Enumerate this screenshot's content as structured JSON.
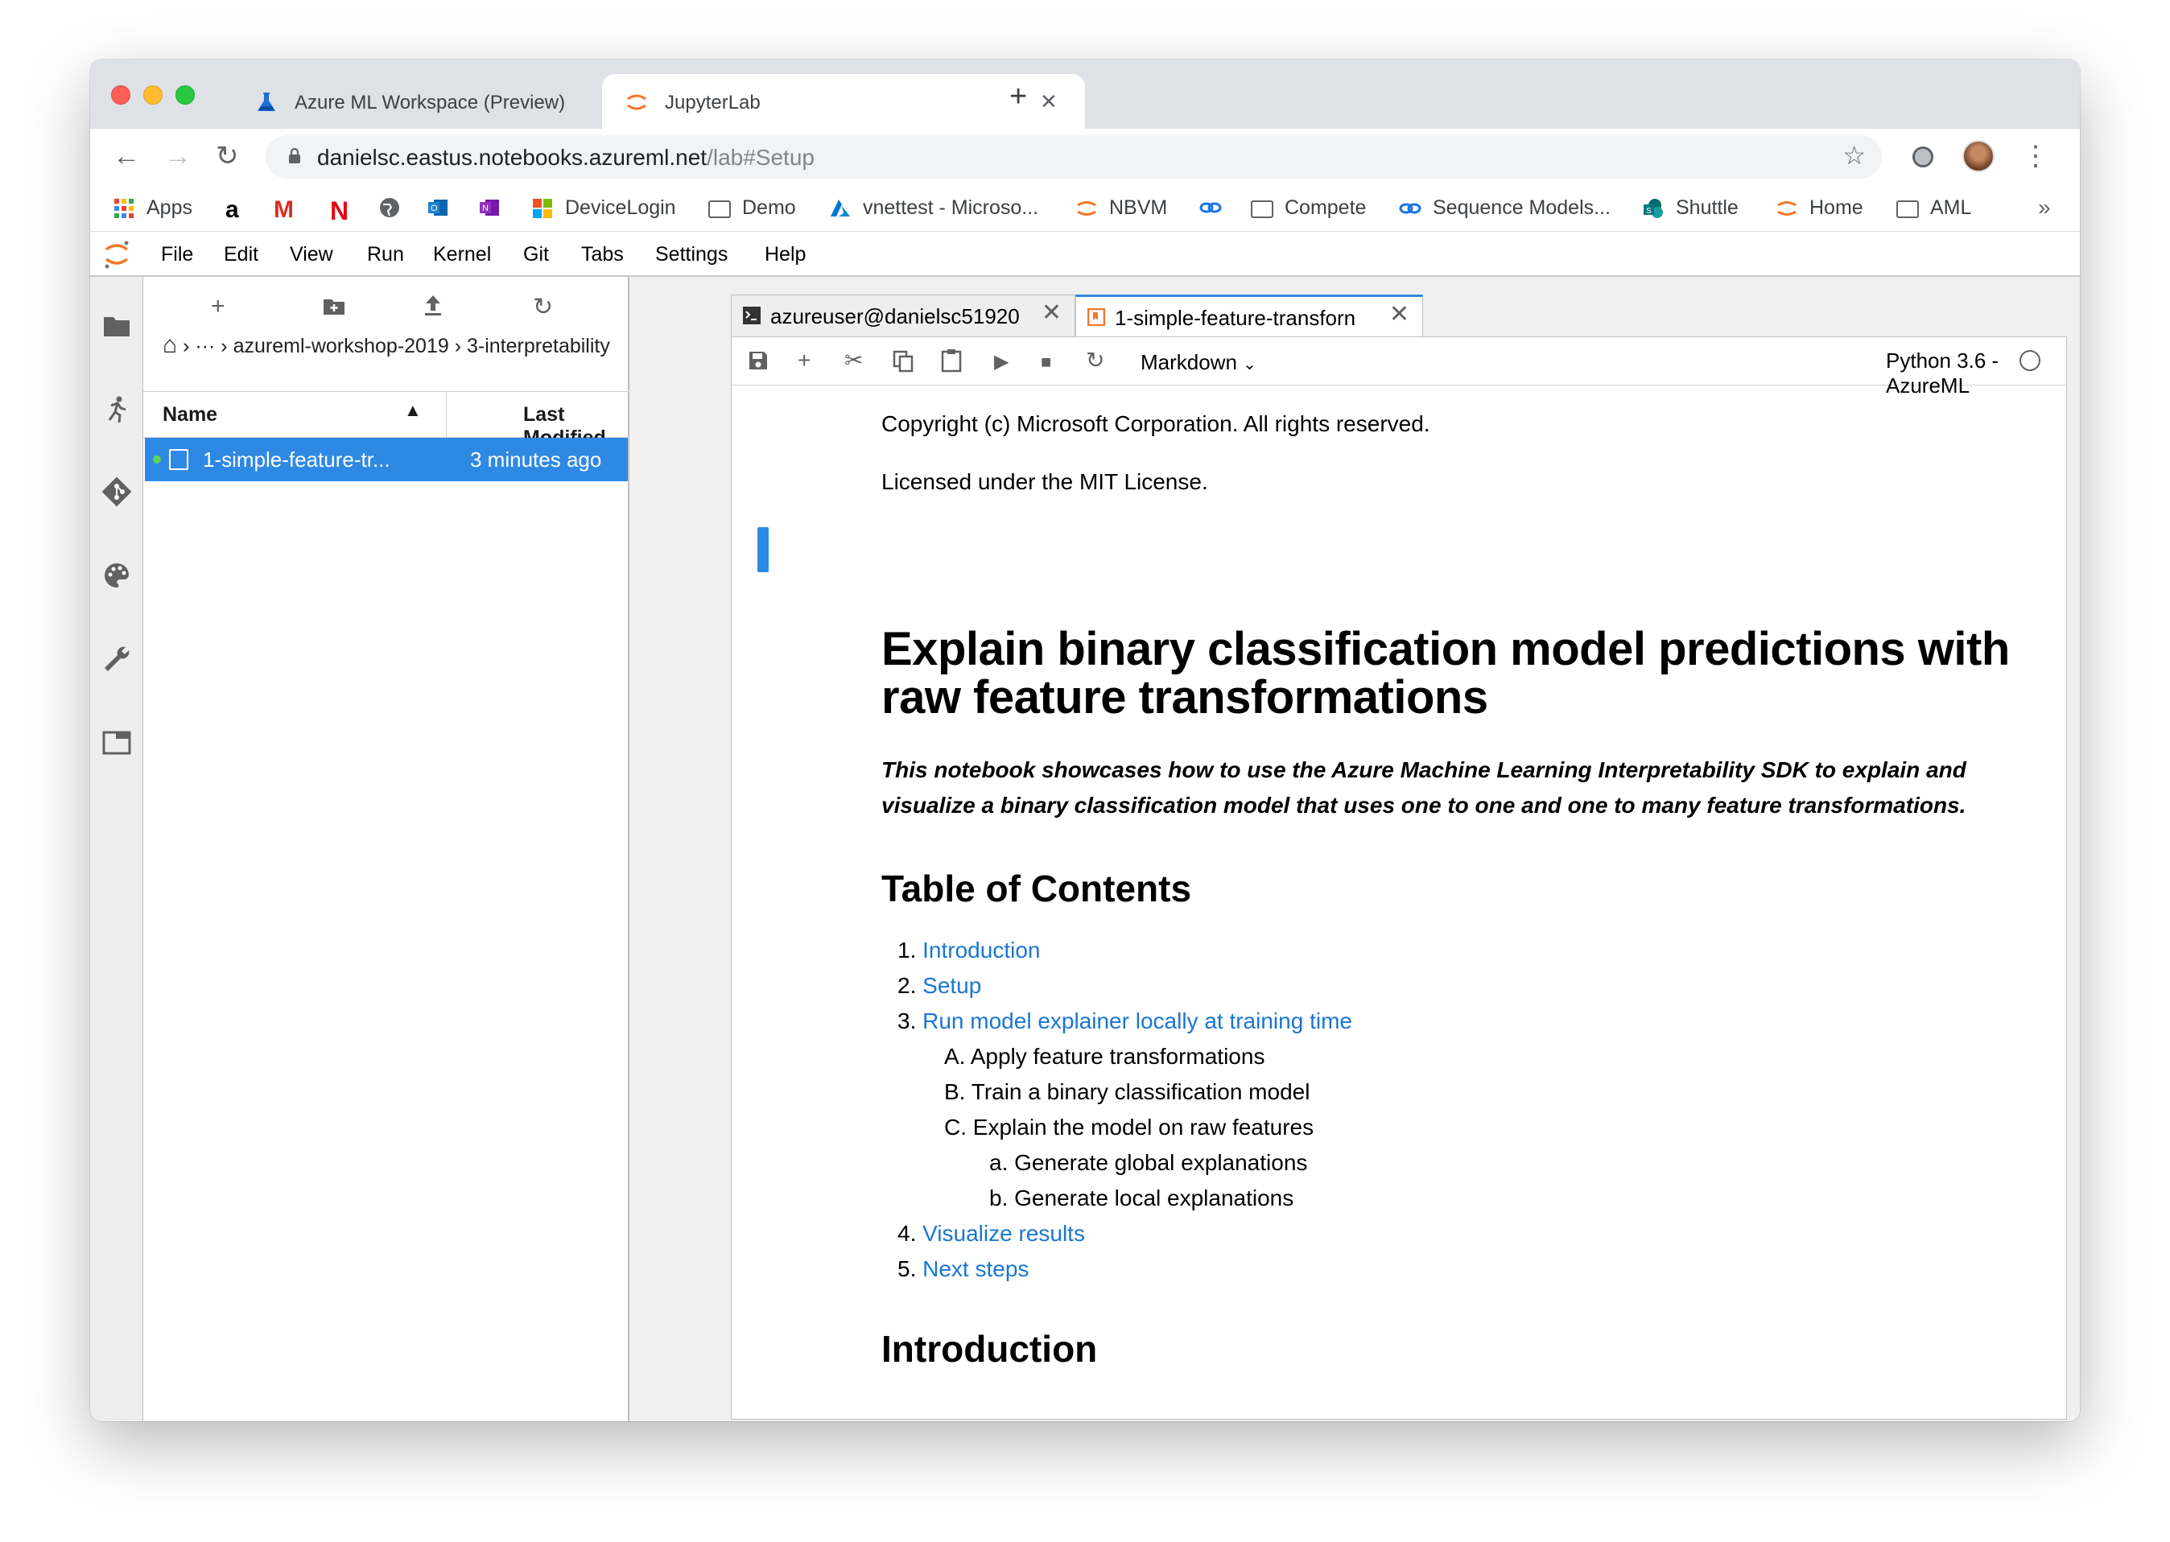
{
  "browser": {
    "tabs": [
      {
        "title": "Azure ML Workspace (Preview)",
        "icon": "azure-ml-flask-icon"
      },
      {
        "title": "JupyterLab",
        "icon": "jupyter-icon"
      }
    ],
    "url_host": "danielsc.eastus.notebooks.azureml.net",
    "url_path": "/lab#Setup",
    "bookmarks": [
      {
        "label": "Apps",
        "icon": "apps-grid-icon"
      },
      {
        "label": "",
        "icon": "amazon-icon"
      },
      {
        "label": "",
        "icon": "gmail-icon"
      },
      {
        "label": "",
        "icon": "netflix-icon"
      },
      {
        "label": "",
        "icon": "globe-icon"
      },
      {
        "label": "",
        "icon": "outlook-icon"
      },
      {
        "label": "",
        "icon": "onenote-icon"
      },
      {
        "label": "DeviceLogin",
        "icon": "microsoft-icon"
      },
      {
        "label": "Demo",
        "icon": "folder-icon"
      },
      {
        "label": "vnettest - Microso...",
        "icon": "azure-icon"
      },
      {
        "label": "NBVM",
        "icon": "jupyter-icon"
      },
      {
        "label": "",
        "icon": "link-icon"
      },
      {
        "label": "Compete",
        "icon": "folder-icon"
      },
      {
        "label": "Sequence Models...",
        "icon": "link-icon"
      },
      {
        "label": "Shuttle",
        "icon": "sharepoint-icon"
      },
      {
        "label": "Home",
        "icon": "jupyter-icon"
      },
      {
        "label": "AML",
        "icon": "folder-icon"
      }
    ],
    "more_bookmarks": "»"
  },
  "menu": [
    "File",
    "Edit",
    "View",
    "Run",
    "Kernel",
    "Git",
    "Tabs",
    "Settings",
    "Help"
  ],
  "filebrowser": {
    "breadcrumb_home": "⌂",
    "breadcrumb_ellipsis": "···",
    "breadcrumb_folder": "azureml-workshop-2019",
    "breadcrumb_sub": "3-interpretability",
    "col_name": "Name",
    "col_modified": "Last Modified",
    "files": [
      {
        "name": "1-simple-feature-tr...",
        "modified": "3 minutes ago",
        "selected": true,
        "running": true
      }
    ]
  },
  "dock": {
    "tabs": [
      {
        "label": "azureuser@danielsc51920",
        "icon": "terminal-icon",
        "active": false
      },
      {
        "label": "1-simple-feature-transforn",
        "icon": "notebook-icon",
        "active": true
      }
    ]
  },
  "notebook": {
    "cell_type": "Markdown",
    "kernel": "Python 3.6 - AzureML",
    "copyright": "Copyright (c) Microsoft Corporation. All rights reserved.",
    "license": "Licensed under the MIT License.",
    "title": "Explain binary classification model predictions with raw feature transformations",
    "lead": "This notebook showcases how to use the Azure Machine Learning Interpretability SDK to explain and visualize a binary classification model that uses one to one and one to many feature transformations.",
    "toc_heading": "Table of Contents",
    "toc": [
      {
        "num": "1.",
        "text": "Introduction",
        "link": true,
        "level": 0
      },
      {
        "num": "2.",
        "text": "Setup",
        "link": true,
        "level": 0
      },
      {
        "num": "3.",
        "text": "Run model explainer locally at training time",
        "link": true,
        "level": 0
      },
      {
        "num": "A.",
        "text": "Apply feature transformations",
        "link": false,
        "level": 1
      },
      {
        "num": "B.",
        "text": "Train a binary classification model",
        "link": false,
        "level": 1
      },
      {
        "num": "C.",
        "text": "Explain the model on raw features",
        "link": false,
        "level": 1
      },
      {
        "num": "a.",
        "text": "Generate global explanations",
        "link": false,
        "level": 2
      },
      {
        "num": "b.",
        "text": "Generate local explanations",
        "link": false,
        "level": 2
      },
      {
        "num": "4.",
        "text": "Visualize results",
        "link": true,
        "level": 0
      },
      {
        "num": "5.",
        "text": "Next steps",
        "link": true,
        "level": 0
      }
    ],
    "intro_heading": "Introduction"
  },
  "colors": {
    "accent": "#2e89e5",
    "link": "#1976d2",
    "jupyter_orange": "#f37726"
  }
}
